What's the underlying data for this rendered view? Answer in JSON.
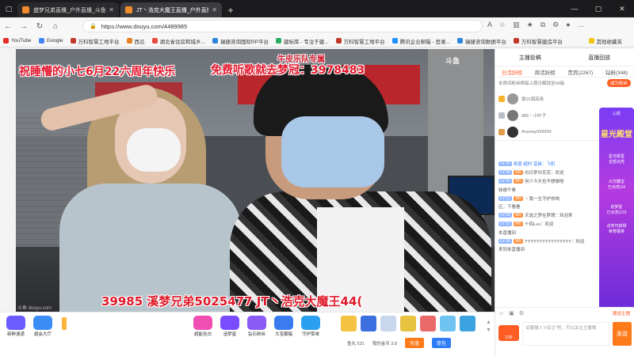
{
  "browser": {
    "tabs": [
      {
        "title": "盛梦兄弟直播_户外直播_斗鱼直播"
      },
      {
        "title": "JT丶浩克大魔王直播_户外直播"
      }
    ],
    "url": "https://www.douyu.com/4489985",
    "bookmarks": [
      "YouTube",
      "Google",
      "万科智慧工地平台",
      "西瓜",
      "湖北省住房和城乡...",
      "瑞捷咨询国际RP平台",
      "建标库 - 专注于建...",
      "万科智慧工地平台",
      "腾讯企业邮箱 - 登录...",
      "瑞捷咨询数据平台",
      "万科智慧建造平台"
    ],
    "other_bookmarks": "其他收藏夹"
  },
  "video": {
    "overlay_line1": "祝睡懵的小七6月22六周年快乐",
    "overlay_line2": "免费听歌就去梦冠：3978483",
    "overlay_small": "牛皮乐队专属",
    "bottom_scroll": "39985   溪梦兄弟5025477   JT丶浩克大魔王44(",
    "logo": "斗鱼",
    "watermark": "斗鱼 douyu.com"
  },
  "giftbar": {
    "left_buttons": [
      "新鲜速递",
      "超会大厅"
    ],
    "features": [
      "超能告白",
      "追梦星",
      "钻石粉丝",
      "大宝藏箱",
      "守护菜单"
    ],
    "stats": {
      "gold": "鱼丸 531",
      "mybalance": "我的金币 3.8"
    },
    "recharge": "充值",
    "bag": "背包"
  },
  "rpanel": {
    "top_left": "主播投稿",
    "top_right": "直播回放",
    "tabs": [
      "日活跃榜",
      "周活跃榜",
      "贵宾(2267)",
      "钻粉(348)"
    ],
    "notice": "本房间粉丝榜每上周日解锁至69级",
    "notice_badge": "成为粉丝",
    "fans": [
      "家01周高吸",
      "985丶小叶子",
      "Anyway999999"
    ],
    "promo": {
      "big": "星光殿堂",
      "line1": "心愿",
      "line2": "星光殿堂",
      "line3": "全部点亮",
      "line4": "大交藏宝",
      "line5": "已点亮1/4",
      "line6": "追梦星",
      "line7": "已点亮1/15",
      "line8": "点亮可获得",
      "line9": "荣誉徽章"
    },
    "chat": [
      {
        "lv": "LV 26",
        "fb": "",
        "text": "恭喜 超时 道具：飞机",
        "sys": true
      },
      {
        "lv": "LV 58",
        "fb": "985",
        "text": "白日梦白花花：欢迎",
        "sys": false
      },
      {
        "lv": "LV 41",
        "fb": "985",
        "text": "何少今天也不想做啥",
        "sys": false
      },
      {
        "lv": "",
        "fb": "",
        "text": "妹德千骨",
        "sys": false
      },
      {
        "lv": "LV 51",
        "fb": "985",
        "text": "丶我一生守护你呦",
        "sys": false
      },
      {
        "lv": "",
        "fb": "",
        "text": "区，下看看",
        "sys": false
      },
      {
        "lv": "LV 58",
        "fb": "985",
        "text": "天选之梦在梦想：欢迎来",
        "sys": false
      },
      {
        "lv": "LV 52",
        "fb": "985",
        "text": "十四Luv：欢迎",
        "sys": false
      },
      {
        "lv": "",
        "fb": "",
        "text": "本直播间",
        "sys": false
      },
      {
        "lv": "LV 59",
        "fb": "985",
        "text": "YYYYYYYYYYYYYYYY：欢迎",
        "sys": false
      },
      {
        "lv": "",
        "fb": "",
        "text": "来到本直播间",
        "sys": false
      }
    ],
    "input_placeholder": "试着输入“#关注”吧，可以关注主播哦",
    "input_hint": "赠送主播",
    "send": "发送",
    "level_badge": "239"
  }
}
